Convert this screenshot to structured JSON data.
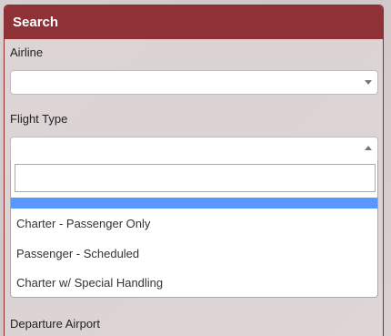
{
  "panel": {
    "title": "Search"
  },
  "fields": {
    "airline_label": "Airline",
    "airline_value": "",
    "flight_type_label": "Flight Type",
    "flight_type_value": "",
    "departure_label": "Departure Airport"
  },
  "dropdown": {
    "search_value": "",
    "options": [
      "",
      "Charter - Passenger Only",
      "Passenger - Scheduled",
      "Charter w/ Special Handling"
    ]
  },
  "colors": {
    "header": "#8f3237",
    "highlight": "#5897fb"
  }
}
